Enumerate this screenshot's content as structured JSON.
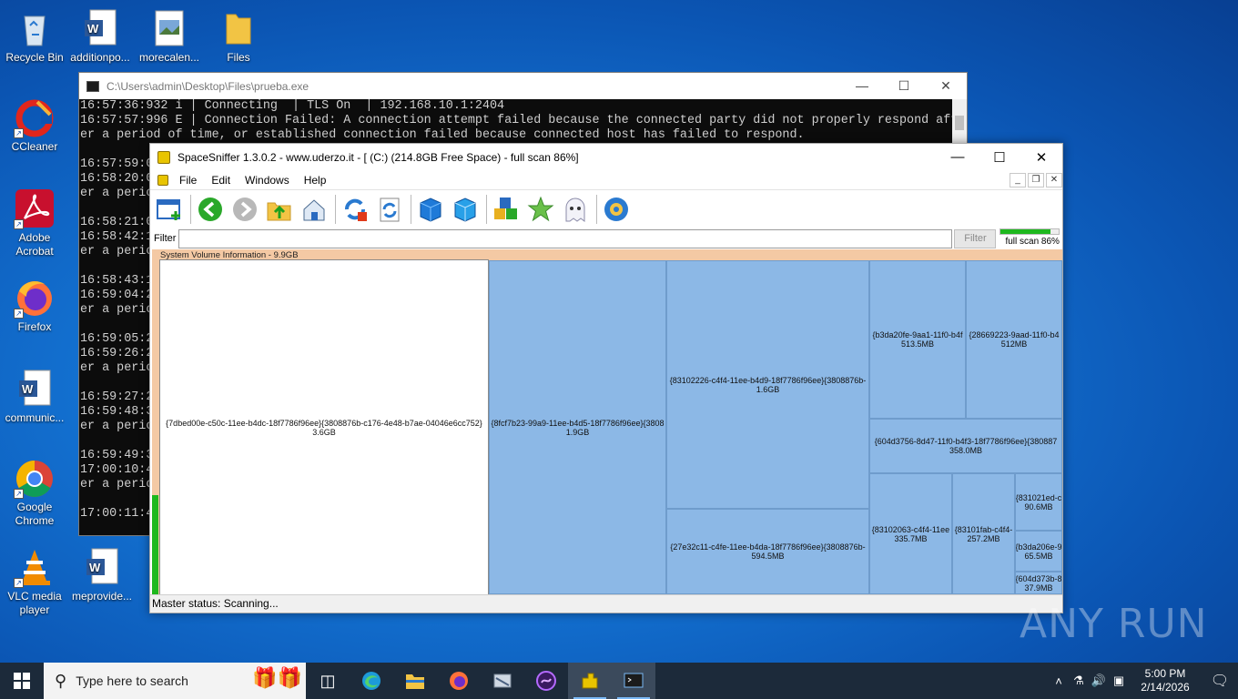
{
  "desktop": {
    "icons": [
      {
        "label": "Recycle Bin"
      },
      {
        "label": "additionpo..."
      },
      {
        "label": "morecalen..."
      },
      {
        "label": "Files"
      },
      {
        "label": "CCleaner"
      },
      {
        "label": "Adobe Acrobat"
      },
      {
        "label": "Firefox"
      },
      {
        "label": "communic..."
      },
      {
        "label": "Google Chrome"
      },
      {
        "label": "VLC media player"
      },
      {
        "label": "meprovide..."
      }
    ]
  },
  "console": {
    "title": "C:\\Users\\admin\\Desktop\\Files\\prueba.exe",
    "lines": "16:57:36:932 i | Connecting  | TLS On  | 192.168.10.1:2404\n16:57:57:996 E | Connection Failed: A connection attempt failed because the connected party did not properly respond aft\ner a period of time, or established connection failed because connected host has failed to respond.\n\n16:57:59:0\n16:58:20:0\ner a perio\n\n16:58:21:0\n16:58:42:1\ner a perio\n\n16:58:43:1\n16:59:04:2\ner a perio\n\n16:59:05:2\n16:59:26:2\ner a perio\n\n16:59:27:2\n16:59:48:3\ner a perio\n\n16:59:49:3\n17:00:10:4\ner a perio\n\n17:00:11:4"
  },
  "spacesniffer": {
    "title": "SpaceSniffer 1.3.0.2 - www.uderzo.it - [ (C:) (214.8GB Free Space) - full scan 86%]",
    "menu": [
      "File",
      "Edit",
      "Windows",
      "Help"
    ],
    "filter_label": "Filter",
    "filter_value": "",
    "filter_button": "Filter",
    "scan_label": "full scan 86%",
    "scan_progress": 0.86,
    "folder_header": "System Volume Information - 9.9GB",
    "cells": [
      {
        "name": "{7dbed00e-c50c-11ee-b4dc-18f7786f96ee}{3808876b-c176-4e48-b7ae-04046e6cc752}",
        "size": "3.6GB"
      },
      {
        "name": "{8fcf7b23-99a9-11ee-b4d5-18f7786f96ee}{3808",
        "size": "1.9GB"
      },
      {
        "name": "{83102226-c4f4-11ee-b4d9-18f7786f96ee}{3808876b-",
        "size": "1.6GB"
      },
      {
        "name": "{27e32c11-c4fe-11ee-b4da-18f7786f96ee}{3808876b-",
        "size": "594.5MB"
      },
      {
        "name": "{b3da20fe-9aa1-11f0-b4f",
        "size": "513.5MB"
      },
      {
        "name": "{28669223-9aad-11f0-b4",
        "size": "512MB"
      },
      {
        "name": "{604d3756-8d47-11f0-b4f3-18f7786f96ee}{380887",
        "size": "358.0MB"
      },
      {
        "name": "{83102063-c4f4-11ee",
        "size": "335.7MB"
      },
      {
        "name": "{83101fab-c4f4-",
        "size": "257.2MB"
      },
      {
        "name": "{831021ed-c",
        "size": "90.6MB"
      },
      {
        "name": "{b3da206e-9",
        "size": "65.5MB"
      },
      {
        "name": "{604d373b-8",
        "size": "37.9MB"
      }
    ],
    "status": "Master status: Scanning..."
  },
  "watermark": "ANY RUN",
  "taskbar": {
    "search_placeholder": "Type here to search",
    "time": "5:00 PM",
    "date": "2/14/2026"
  },
  "icons": {
    "start": "windows-logo-icon",
    "search": "search-icon"
  }
}
